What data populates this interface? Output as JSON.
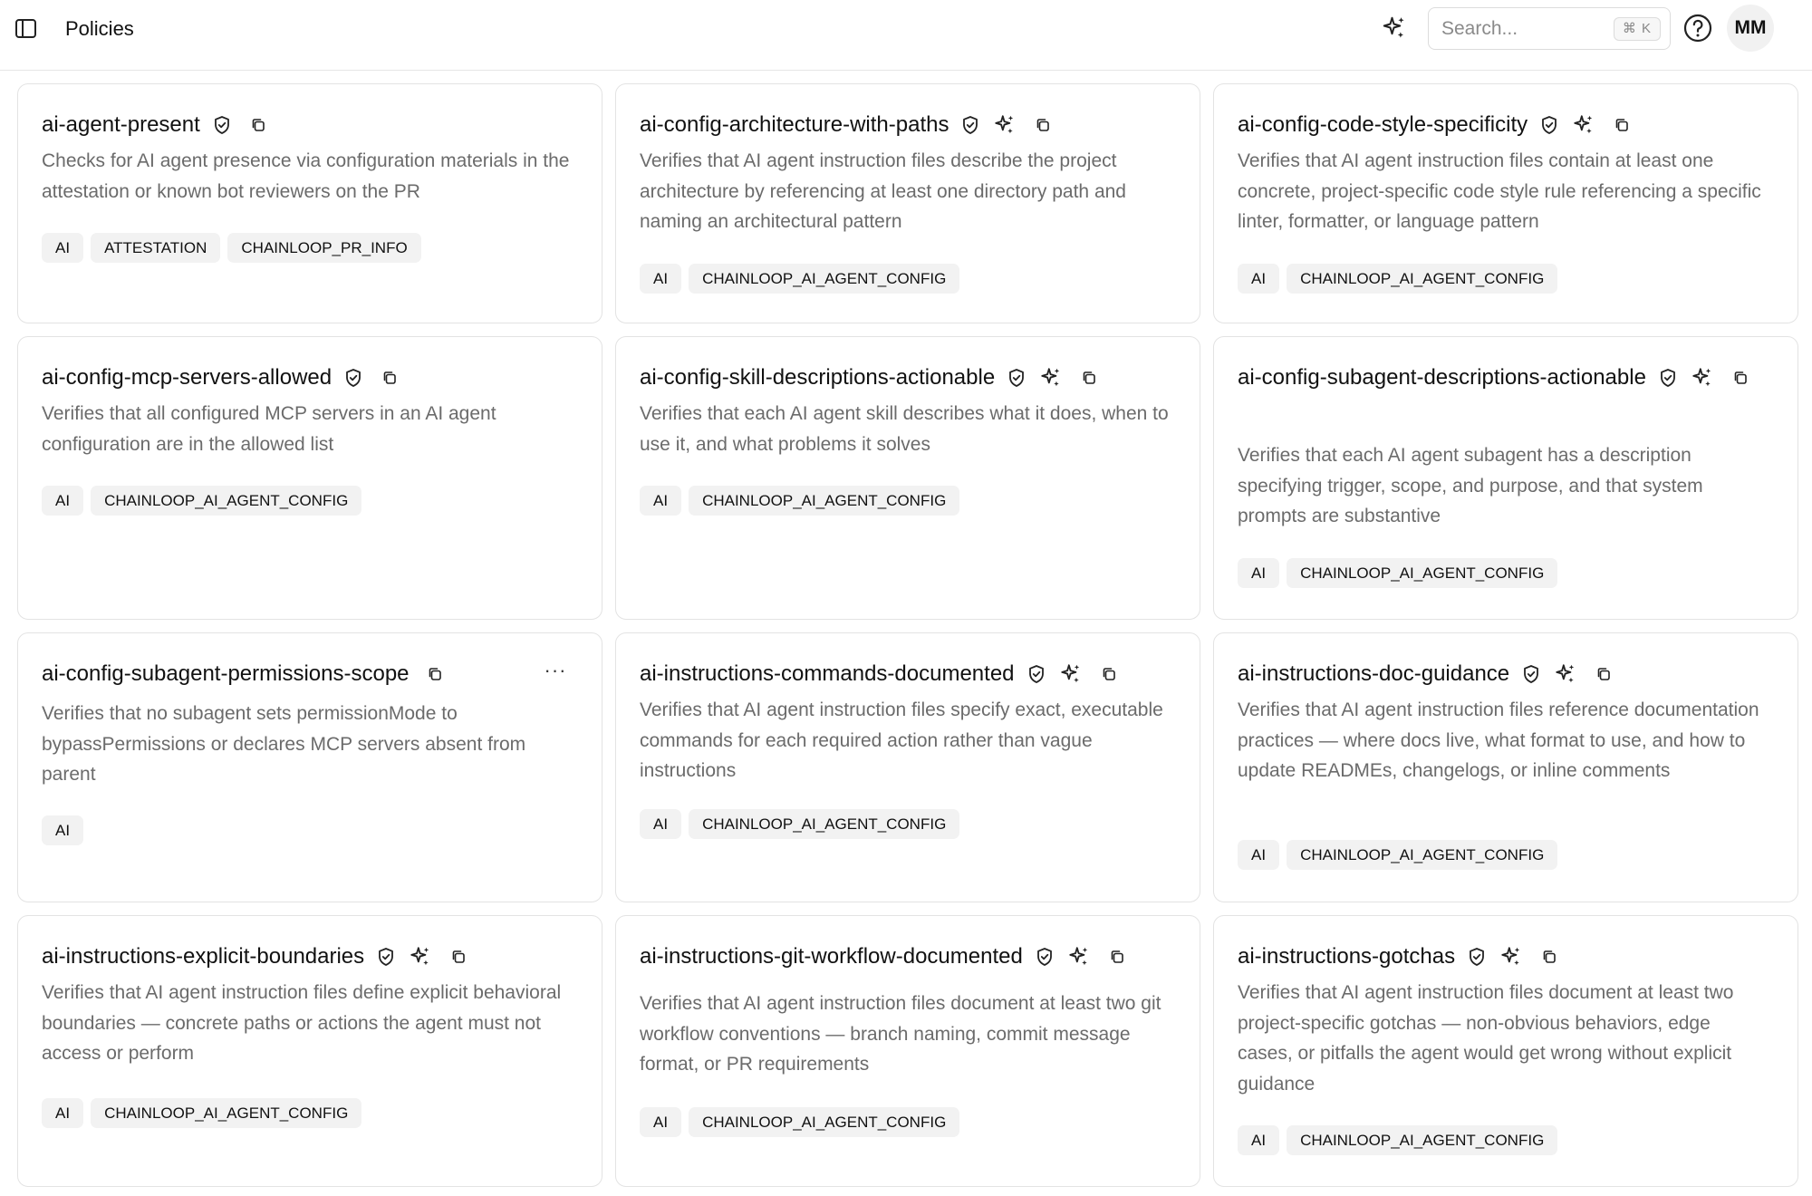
{
  "header": {
    "title": "Policies",
    "search": {
      "placeholder": "Search...",
      "shortcut": "⌘ K"
    },
    "avatar_initials": "MM",
    "icons": [
      "sidebar-toggle-icon",
      "sparkle-icon",
      "help-icon"
    ]
  },
  "colors": {
    "border": "#e3e3e3",
    "tag_bg": "#f2f2f2",
    "muted_text": "#6b6b6b"
  },
  "policies": [
    {
      "name": "ai-agent-present",
      "ai_generated": false,
      "description": "Checks for AI agent presence via configuration materials in the attestation or known bot reviewers on the PR",
      "tags": [
        "AI",
        "ATTESTATION",
        "CHAINLOOP_PR_INFO"
      ]
    },
    {
      "name": "ai-config-architecture-with-paths",
      "ai_generated": true,
      "description": "Verifies that AI agent instruction files describe the project architecture by referencing at least one directory path and naming an architectural pattern",
      "tags": [
        "AI",
        "CHAINLOOP_AI_AGENT_CONFIG"
      ]
    },
    {
      "name": "ai-config-code-style-specificity",
      "ai_generated": true,
      "description": "Verifies that AI agent instruction files contain at least one concrete, project-specific code style rule referencing a specific linter, formatter, or language pattern",
      "tags": [
        "AI",
        "CHAINLOOP_AI_AGENT_CONFIG"
      ]
    },
    {
      "name": "ai-config-mcp-servers-allowed",
      "ai_generated": false,
      "description": "Verifies that all configured MCP servers in an AI agent configuration are in the allowed list",
      "tags": [
        "AI",
        "CHAINLOOP_AI_AGENT_CONFIG"
      ]
    },
    {
      "name": "ai-config-skill-descriptions-actionable",
      "ai_generated": true,
      "description": "Verifies that each AI agent skill describes what it does, when to use it, and what problems it solves",
      "tags": [
        "AI",
        "CHAINLOOP_AI_AGENT_CONFIG"
      ]
    },
    {
      "name": "ai-config-subagent-descriptions-actionable",
      "ai_generated": true,
      "description": "Verifies that each AI agent subagent has a description specifying trigger, scope, and purpose, and that system prompts are substantive",
      "tags": [
        "AI",
        "CHAINLOOP_AI_AGENT_CONFIG"
      ]
    },
    {
      "name": "ai-config-subagent-permissions-scope",
      "ai_generated": false,
      "verified": false,
      "has_more_menu": true,
      "more_label": "···",
      "description": "Verifies that no subagent sets permissionMode to bypassPermissions or declares MCP servers absent from parent",
      "tags": [
        "AI"
      ]
    },
    {
      "name": "ai-instructions-commands-documented",
      "ai_generated": true,
      "description": "Verifies that AI agent instruction files specify exact, executable commands for each required action rather than vague instructions",
      "tags": [
        "AI",
        "CHAINLOOP_AI_AGENT_CONFIG"
      ]
    },
    {
      "name": "ai-instructions-doc-guidance",
      "ai_generated": true,
      "description": "Verifies that AI agent instruction files reference documentation practices — where docs live, what format to use, and how to update READMEs, changelogs, or inline comments",
      "tags": [
        "AI",
        "CHAINLOOP_AI_AGENT_CONFIG"
      ]
    },
    {
      "name": "ai-instructions-explicit-boundaries",
      "ai_generated": true,
      "description": "Verifies that AI agent instruction files define explicit behavioral boundaries — concrete paths or actions the agent must not access or perform",
      "tags": [
        "AI",
        "CHAINLOOP_AI_AGENT_CONFIG"
      ]
    },
    {
      "name": "ai-instructions-git-workflow-documented",
      "ai_generated": true,
      "description": "Verifies that AI agent instruction files document at least two git workflow conventions — branch naming, commit message format, or PR requirements",
      "tags": [
        "AI",
        "CHAINLOOP_AI_AGENT_CONFIG"
      ]
    },
    {
      "name": "ai-instructions-gotchas",
      "ai_generated": true,
      "description": "Verifies that AI agent instruction files document at least two project-specific gotchas — non-obvious behaviors, edge cases, or pitfalls the agent would get wrong without explicit guidance",
      "tags": [
        "AI",
        "CHAINLOOP_AI_AGENT_CONFIG"
      ]
    }
  ]
}
